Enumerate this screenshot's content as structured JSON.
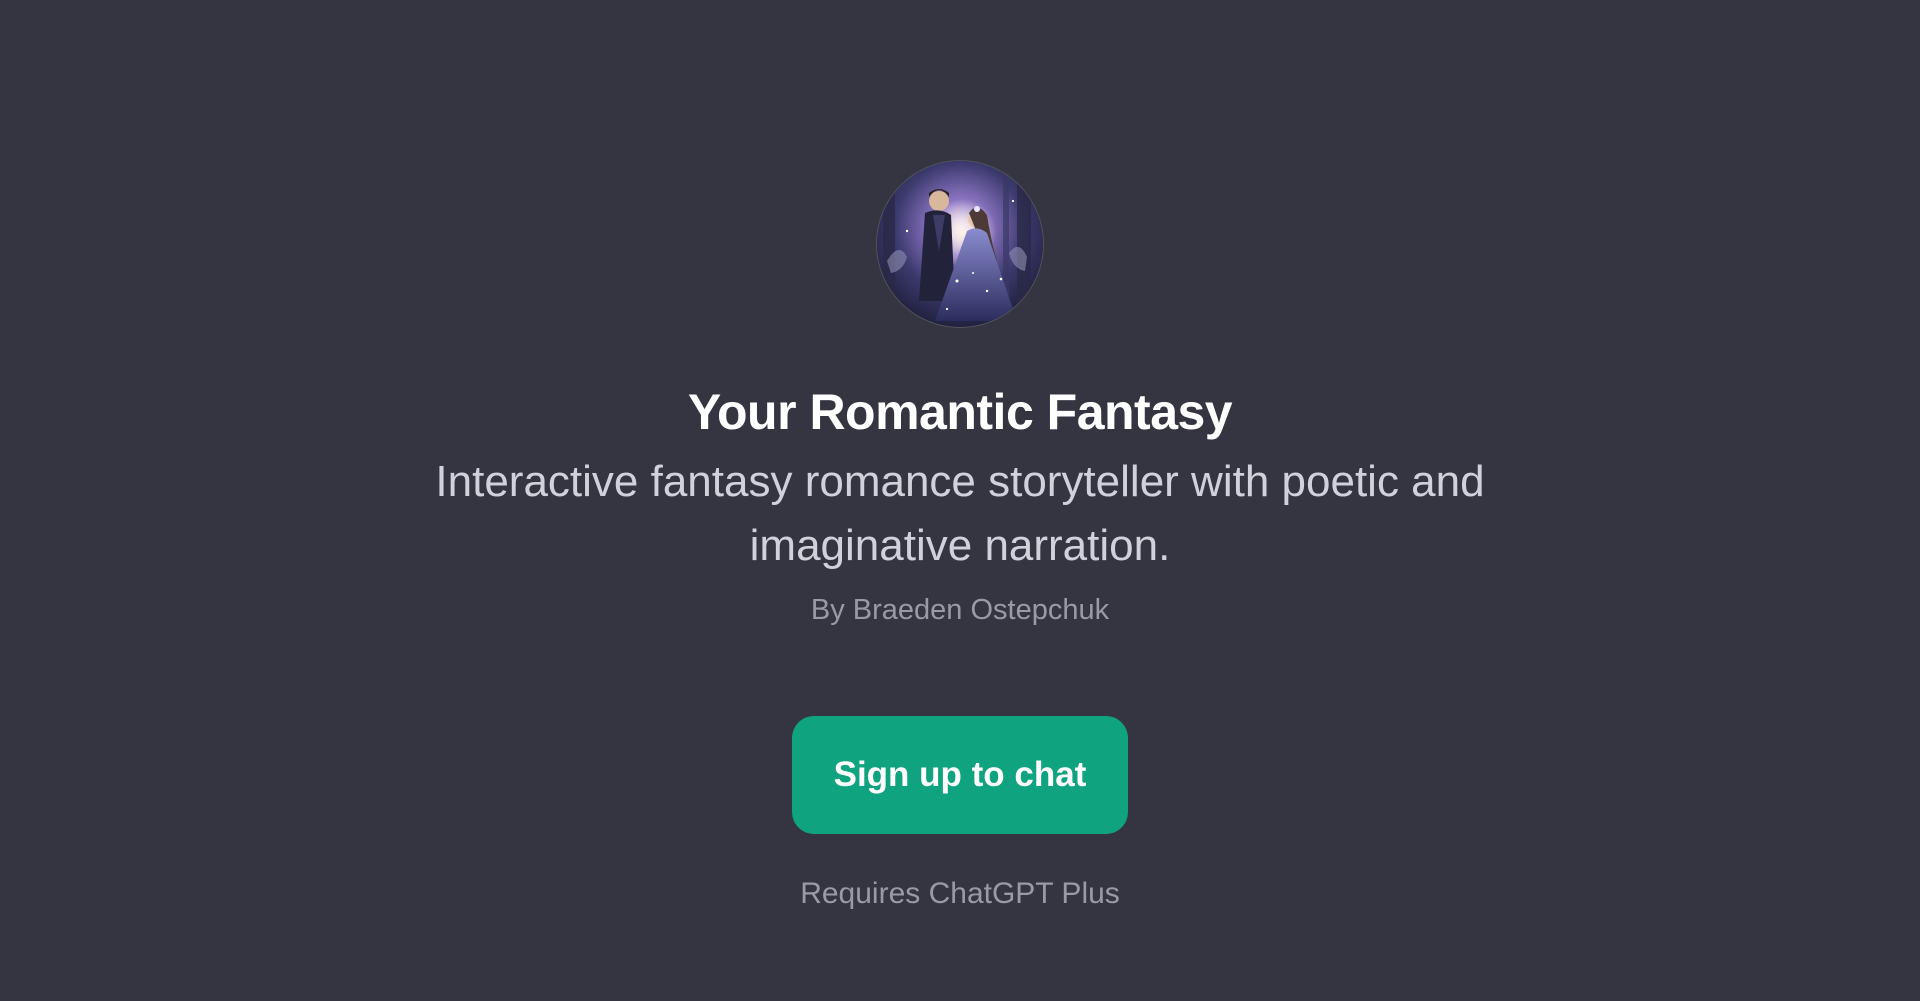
{
  "gpt": {
    "avatar_icon": "romantic-couple-avatar",
    "title": "Your Romantic Fantasy",
    "description": "Interactive fantasy romance storyteller with poetic and imaginative narration.",
    "author": "By Braeden Ostepchuk"
  },
  "cta": {
    "label": "Sign up to chat"
  },
  "requirement": "Requires ChatGPT Plus",
  "colors": {
    "background": "#343541",
    "accent": "#10a37f",
    "title": "#ffffff",
    "description": "#d1d1db",
    "muted": "#9a9aa6"
  }
}
